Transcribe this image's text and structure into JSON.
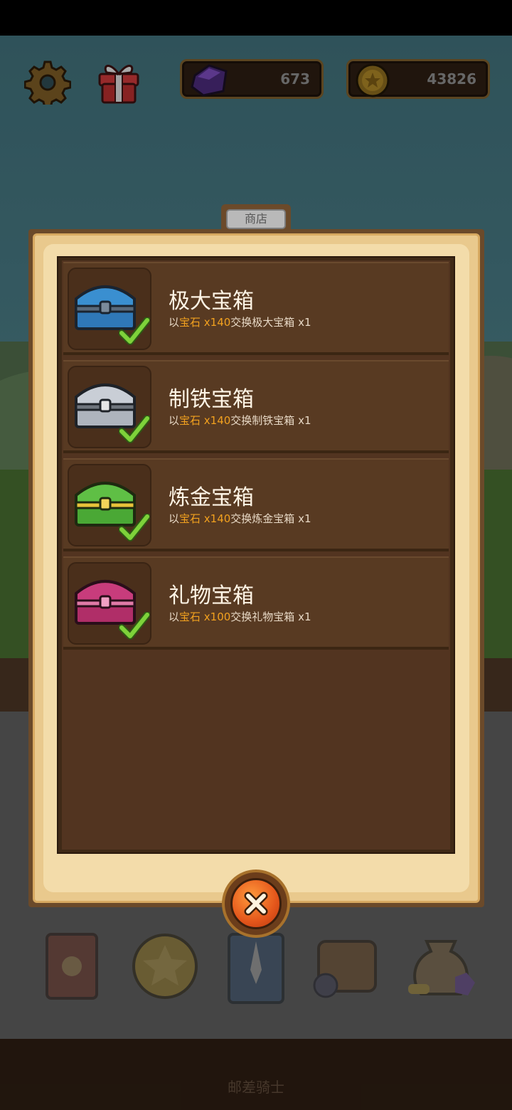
{
  "hud": {
    "gems": "673",
    "coins": "43826",
    "settings_icon": "gear-icon",
    "gift_icon": "gift-box-icon"
  },
  "shop": {
    "title": "商店",
    "items": [
      {
        "name": "极大宝箱",
        "desc_prefix": "以",
        "currency": "宝石 x140",
        "desc_suffix": "交换极大宝箱 x1",
        "chest_color": "#3a8fd0",
        "icon": "blue-chest-icon",
        "purchased": true
      },
      {
        "name": "制铁宝箱",
        "desc_prefix": "以",
        "currency": "宝石 x140",
        "desc_suffix": "交换制铁宝箱 x1",
        "chest_color": "#c9ced6",
        "icon": "iron-chest-icon",
        "purchased": true
      },
      {
        "name": "炼金宝箱",
        "desc_prefix": "以",
        "currency": "宝石 x140",
        "desc_suffix": "交换炼金宝箱 x1",
        "chest_color": "#5fbf45",
        "icon": "green-gold-chest-icon",
        "purchased": true
      },
      {
        "name": "礼物宝箱",
        "desc_prefix": "以",
        "currency": "宝石 x100",
        "desc_suffix": "交换礼物宝箱 x1",
        "chest_color": "#c83c7c",
        "icon": "pink-gift-chest-icon",
        "purchased": true
      }
    ],
    "close_icon": "close-icon"
  },
  "bottom_menu": {
    "items": [
      "book-icon",
      "star-coin-icon",
      "sword-card-icon",
      "backpack-potion-icon",
      "loot-bag-icon"
    ],
    "label": "邮差骑士"
  },
  "colors": {
    "highlight": "#f2a11f",
    "check": "#7ed23a"
  }
}
